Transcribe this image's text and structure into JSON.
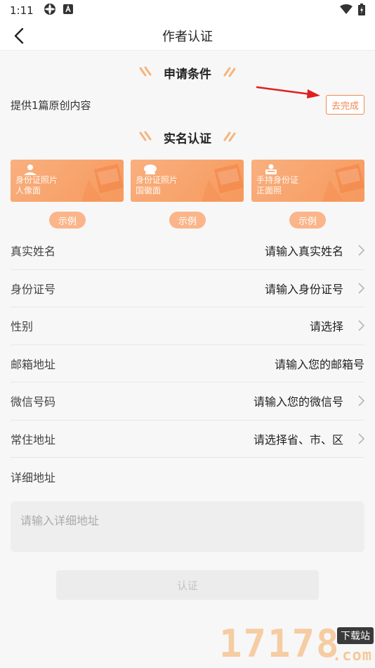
{
  "status_bar": {
    "time": "1:11",
    "icons": [
      "settings-icon",
      "a-icon",
      "wifi-icon",
      "battery-charging-icon"
    ]
  },
  "nav": {
    "title": "作者认证",
    "back_icon": "back-arrow-icon"
  },
  "conditions": {
    "heading": "申请条件",
    "requirement": "提供1篇原创内容",
    "complete_label": "去完成"
  },
  "verification": {
    "heading": "实名认证",
    "cards": [
      {
        "text": "身份证照片\n人像面",
        "icon": "person-icon"
      },
      {
        "text": "身份证照片\n国徽面",
        "icon": "emblem-icon"
      },
      {
        "text": "手持身份证\n正面照",
        "icon": "hand-card-icon"
      }
    ],
    "example_label": "示例"
  },
  "form": {
    "rows": [
      {
        "label": "真实姓名",
        "value": "请输入真实姓名",
        "chevron": true
      },
      {
        "label": "身份证号",
        "value": "请输入身份证号",
        "chevron": true
      },
      {
        "label": "性别",
        "value": "请选择",
        "chevron": true
      },
      {
        "label": "邮箱地址",
        "value": "请输入您的邮箱号",
        "chevron": false
      },
      {
        "label": "微信号码",
        "value": "请输入您的微信号",
        "chevron": true
      },
      {
        "label": "常住地址",
        "value": "请选择省、市、区",
        "chevron": true
      }
    ],
    "detail_label": "详细地址",
    "detail_placeholder": "请输入详细地址"
  },
  "submit_label": "认证",
  "watermark": {
    "digits": "17178",
    "badge": "下载站",
    "domain": ".com"
  },
  "colors": {
    "accent": "#f0894d",
    "card": "#f6995d",
    "example": "#fbb58a",
    "annotation_arrow": "#e02020"
  }
}
